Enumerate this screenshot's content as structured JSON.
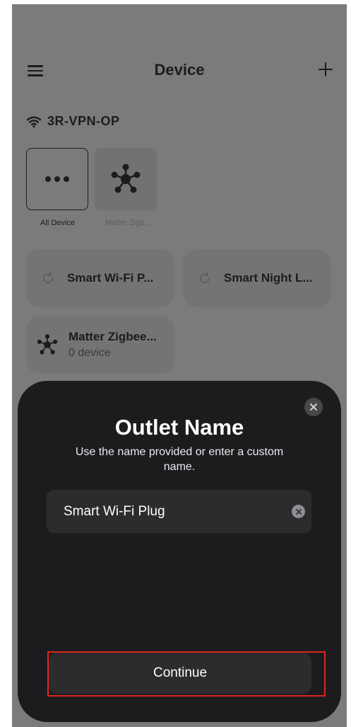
{
  "header": {
    "title": "Device"
  },
  "network": {
    "name": "3R-VPN-OP"
  },
  "categories": [
    {
      "label": "All Device",
      "icon": "more-dots-icon"
    },
    {
      "label": "Matter Zigb...",
      "icon": "network-hub-icon"
    }
  ],
  "devices": [
    {
      "name": "Smart Wi-Fi P...",
      "icon": "refresh-icon"
    },
    {
      "name": "Smart Night L...",
      "icon": "refresh-icon"
    },
    {
      "name": "Matter Zigbee...",
      "subtitle": "0 device",
      "icon": "network-hub-icon"
    }
  ],
  "modal": {
    "title": "Outlet Name",
    "subtitle": "Use the name provided or enter a custom name.",
    "input_value": "Smart Wi-Fi Plug",
    "continue_label": "Continue"
  },
  "colors": {
    "overlay": "#7b7b7d",
    "sheet": "#1c1c1e",
    "field": "#2c2c2e",
    "highlight": "#e0241f"
  }
}
